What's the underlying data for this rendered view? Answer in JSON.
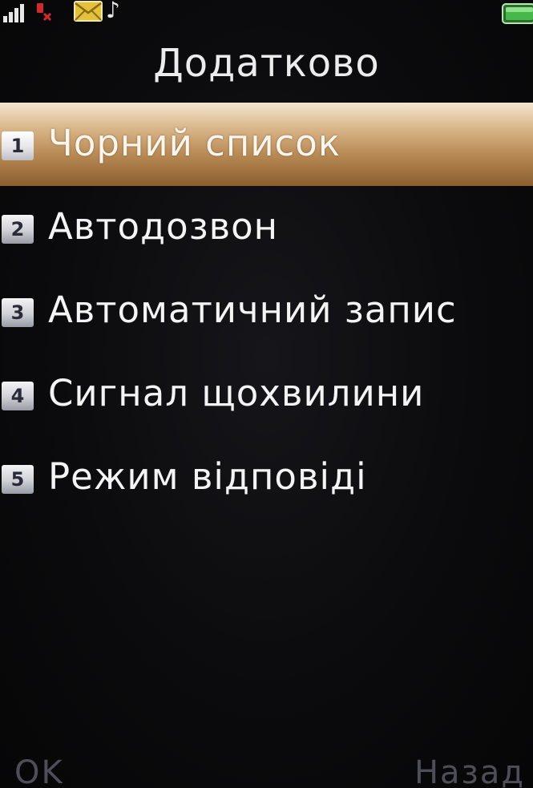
{
  "status_bar": {
    "icons": [
      "signal-strength-icon",
      "no-sim-icon",
      "message-envelope-icon",
      "music-note-icon",
      "battery-icon"
    ],
    "battery_color": "#46b84a",
    "nosim_color": "#d22a2a",
    "envelope_color": "#e4c13a",
    "note_glyph": "♪"
  },
  "title": "Додатково",
  "menu": {
    "selected_index": 0,
    "highlight_color": "#c49a63",
    "items": [
      {
        "number": "1",
        "label": "Чорний список"
      },
      {
        "number": "2",
        "label": "Автодозвон"
      },
      {
        "number": "3",
        "label": "Автоматичний запис"
      },
      {
        "number": "4",
        "label": "Сигнал щохвилини"
      },
      {
        "number": "5",
        "label": "Режим відповіді"
      }
    ]
  },
  "softkeys": {
    "left": "OK",
    "right": "Назад"
  }
}
